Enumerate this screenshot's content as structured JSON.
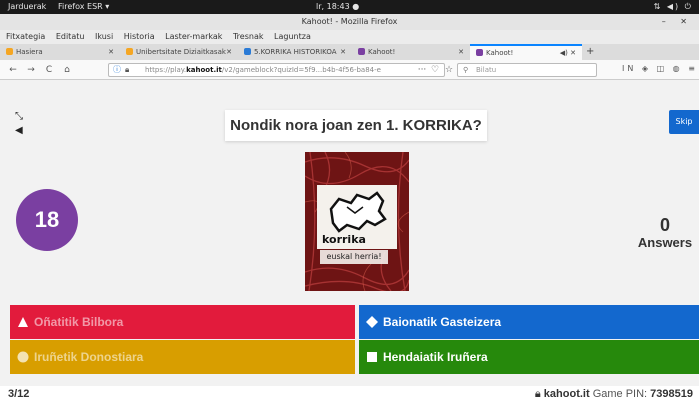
{
  "system_bar": {
    "activities": "Jarduerak",
    "app_menu": "Firefox ESR ▾",
    "clock": "lr, 18:43 ●",
    "status_icons": "⇅ ◀) ⏻"
  },
  "window": {
    "title": "Kahoot! - Mozilla Firefox",
    "controls": "– ✕"
  },
  "menu": [
    "Fitxategia",
    "Editatu",
    "Ikusi",
    "Historia",
    "Laster-markak",
    "Tresnak",
    "Laguntza"
  ],
  "tabs": [
    {
      "label": "Hasiera",
      "close": "✕",
      "favicon_color": "#f5a623"
    },
    {
      "label": "Unibertsitate Diziaitkasak",
      "close": "✕",
      "favicon_color": "#f5a623"
    },
    {
      "label": "5.KORRIKA HISTORIKOA",
      "close": "✕",
      "favicon_color": "#2b7bd6"
    },
    {
      "label": "Kahoot!",
      "close": "✕",
      "favicon_color": "#7a3fa1"
    },
    {
      "label": "Kahoot!",
      "close": "✕",
      "favicon_color": "#7a3fa1"
    }
  ],
  "tab_extra": {
    "audio": "◀) ✕",
    "new_tab": "+"
  },
  "nav": {
    "back": "←",
    "forward": "→",
    "reload": "C",
    "home": "⌂",
    "url_prefix": "https://play.",
    "url_host": "kahoot.it",
    "url_rest": "/v2/gameblock?quizId=5f9...b4b-4f56-ba84-e",
    "url_more": "···",
    "bookmark": "☆",
    "pocket": "♡",
    "search_placeholder": "Bilatu",
    "right_icons": "IN ◈ ◫ ◍ ≡"
  },
  "game": {
    "question": "Nondik nora joan zen 1. KORRIKA?",
    "skip": "Skip",
    "timer": "18",
    "answers_count": "0",
    "answers_label": "Answers",
    "image_brand": "korrika",
    "image_sub": "euskal herria!",
    "options": [
      {
        "label": "Oñatitik Bilbora",
        "color": "#e21b3c",
        "shape": "triangle"
      },
      {
        "label": "Baionatik Gasteizera",
        "color": "#1368ce",
        "shape": "diamond"
      },
      {
        "label": "Iruñetik Donostiara",
        "color": "#d89e00",
        "shape": "circle"
      },
      {
        "label": "Hendaiatik Iruñera",
        "color": "#26890c",
        "shape": "square"
      }
    ],
    "progress": "3/12",
    "site": "kahoot.it",
    "pin_label": "Game PIN:",
    "pin": "7398519"
  }
}
